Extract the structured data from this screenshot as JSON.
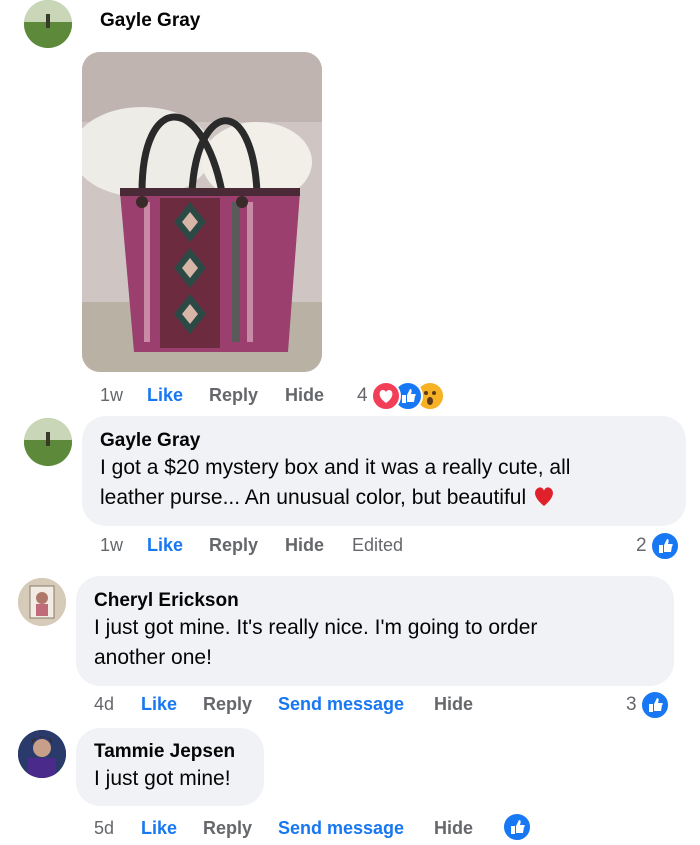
{
  "comments": [
    {
      "author": "Gayle Gray",
      "time": "1w",
      "like": "Like",
      "reply": "Reply",
      "hide": "Hide",
      "reaction_count": "4",
      "reactions": [
        "love-icon",
        "like-icon",
        "wow-icon"
      ],
      "has_photo": true
    },
    {
      "author": "Gayle Gray",
      "text": "I got a $20 mystery box and it was a really cute, all leather purse... An unusual color, but beautiful",
      "text_line1": "I got a $20 mystery box and it was a really cute, all",
      "text_line2": "leather purse... An unusual color, but beautiful",
      "emoji": "red-heart-icon",
      "time": "1w",
      "like": "Like",
      "reply": "Reply",
      "hide": "Hide",
      "edited": "Edited",
      "reaction_count": "2",
      "reactions": [
        "like-icon"
      ]
    },
    {
      "author": "Cheryl Erickson",
      "text": "I just got mine. It's really nice. I'm going to order another one!",
      "text_line1": "I just got mine. It's really nice. I'm going to order",
      "text_line2": "another one!",
      "time": "4d",
      "like": "Like",
      "reply": "Reply",
      "send": "Send message",
      "hide": "Hide",
      "reaction_count": "3",
      "reactions": [
        "like-icon"
      ]
    },
    {
      "author": "Tammie Jepsen",
      "text": "I just got mine!",
      "time": "5d",
      "like": "Like",
      "reply": "Reply",
      "send": "Send message",
      "hide": "Hide",
      "reactions": [
        "like-icon"
      ]
    }
  ],
  "colors": {
    "link_blue": "#1877f2",
    "meta_gray": "#65676b",
    "bubble_bg": "#f0f2f5",
    "love_red": "#f33e58",
    "wow_yellow": "#f7b125",
    "purse_magenta": "#9b3f6e"
  }
}
